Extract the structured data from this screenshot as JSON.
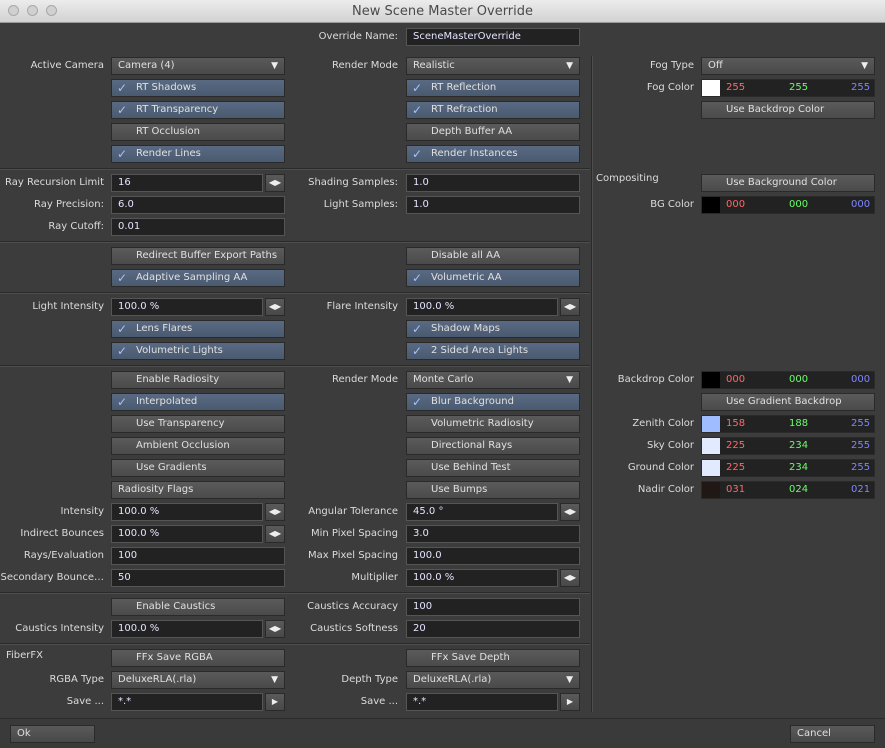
{
  "window": {
    "title": "New Scene Master Override"
  },
  "override_name": {
    "label": "Override Name:",
    "value": "SceneMasterOverride"
  },
  "render": {
    "active_camera_label": "Active Camera",
    "active_camera": "Camera (4)",
    "render_mode_label": "Render Mode",
    "render_mode": "Realistic",
    "rt_shadows": "RT Shadows",
    "rt_reflection": "RT Reflection",
    "rt_transparency": "RT Transparency",
    "rt_refraction": "RT Refraction",
    "rt_occlusion": "RT Occlusion",
    "depth_buffer_aa": "Depth Buffer AA",
    "render_lines": "Render Lines",
    "render_instances": "Render Instances"
  },
  "raytrace": {
    "ray_recursion_label": "Ray Recursion Limit",
    "ray_recursion": "16",
    "ray_precision_label": "Ray Precision:",
    "ray_precision": "6.0",
    "ray_cutoff_label": "Ray Cutoff:",
    "ray_cutoff": "0.01",
    "shading_samples_label": "Shading Samples:",
    "shading_samples": "1.0",
    "light_samples_label": "Light Samples:",
    "light_samples": "1.0"
  },
  "aa": {
    "redirect": "Redirect Buffer Export Paths",
    "disable_aa": "Disable all AA",
    "adaptive": "Adaptive Sampling AA",
    "volumetric_aa": "Volumetric AA"
  },
  "lights": {
    "light_intensity_label": "Light Intensity",
    "light_intensity": "100.0 %",
    "flare_intensity_label": "Flare Intensity",
    "flare_intensity": "100.0 %",
    "lens_flares": "Lens Flares",
    "shadow_maps": "Shadow Maps",
    "volumetric_lights": "Volumetric Lights",
    "two_sided": "2 Sided Area Lights"
  },
  "radiosity": {
    "enable": "Enable Radiosity",
    "render_mode_label": "Render Mode",
    "render_mode": "Monte Carlo",
    "interpolated": "Interpolated",
    "blur_background": "Blur Background",
    "use_transparency": "Use Transparency",
    "volumetric_radiosity": "Volumetric Radiosity",
    "ambient_occlusion": "Ambient Occlusion",
    "directional_rays": "Directional Rays",
    "use_gradients": "Use Gradients",
    "use_behind_test": "Use Behind Test",
    "flags": "Radiosity Flags",
    "use_bumps": "Use Bumps",
    "intensity_label": "Intensity",
    "intensity": "100.0 %",
    "angular_label": "Angular Tolerance",
    "angular": "45.0 °",
    "indirect_label": "Indirect Bounces",
    "indirect": "100.0 %",
    "min_spacing_label": "Min Pixel Spacing",
    "min_spacing": "3.0",
    "rays_label": "Rays/Evaluation",
    "rays": "100",
    "max_spacing_label": "Max Pixel Spacing",
    "max_spacing": "100.0",
    "secondary_label": "Secondary Bounce…",
    "secondary": "50",
    "multiplier_label": "Multiplier",
    "multiplier": "100.0 %"
  },
  "caustics": {
    "enable": "Enable Caustics",
    "accuracy_label": "Caustics Accuracy",
    "accuracy": "100",
    "intensity_label": "Caustics Intensity",
    "intensity": "100.0 %",
    "softness_label": "Caustics Softness",
    "softness": "20"
  },
  "fiberfx": {
    "section": "FiberFX",
    "save_rgba": "FFx Save RGBA",
    "save_depth": "FFx Save Depth",
    "rgba_type_label": "RGBA Type",
    "rgba_type": "DeluxeRLA(.rla)",
    "depth_type_label": "Depth Type",
    "depth_type": "DeluxeRLA(.rla)",
    "save_label": "Save ...",
    "save_value": "*.*",
    "save2_label": "Save ...",
    "save2_value": "*.*"
  },
  "fog": {
    "type_label": "Fog Type",
    "type": "Off",
    "color_label": "Fog Color",
    "r": "255",
    "g": "255",
    "b": "255",
    "swatch": "#ffffff",
    "use_backdrop": "Use Backdrop Color"
  },
  "compositing": {
    "section": "Compositing",
    "use_bg": "Use Background Color",
    "bg_label": "BG Color",
    "r": "000",
    "g": "000",
    "b": "000",
    "swatch": "#000000"
  },
  "backdrop": {
    "label": "Backdrop Color",
    "r": "000",
    "g": "000",
    "b": "000",
    "swatch": "#000000",
    "use_gradient": "Use Gradient Backdrop",
    "zenith_label": "Zenith Color",
    "zenith_r": "158",
    "zenith_g": "188",
    "zenith_b": "255",
    "zenith_swatch": "#9ebcff",
    "sky_label": "Sky Color",
    "sky_r": "225",
    "sky_g": "234",
    "sky_b": "255",
    "sky_swatch": "#e1eaff",
    "ground_label": "Ground Color",
    "ground_r": "225",
    "ground_g": "234",
    "ground_b": "255",
    "ground_swatch": "#e1eaff",
    "nadir_label": "Nadir Color",
    "nadir_r": "031",
    "nadir_g": "024",
    "nadir_b": "021",
    "nadir_swatch": "#1f1815"
  },
  "footer": {
    "ok": "Ok",
    "cancel": "Cancel"
  }
}
